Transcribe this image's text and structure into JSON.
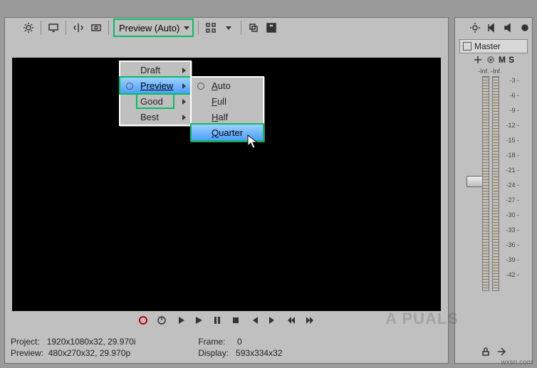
{
  "toolbar": {
    "preview_dropdown": "Preview (Auto)"
  },
  "quality_menu": {
    "items": [
      "Draft",
      "Preview",
      "Good",
      "Best"
    ],
    "selected_index": 1
  },
  "resolution_menu": {
    "items": [
      {
        "label": "Auto",
        "u": "A"
      },
      {
        "label": "Full",
        "u": "F"
      },
      {
        "label": "Half",
        "u": "H"
      },
      {
        "label": "Quarter",
        "u": "Q"
      }
    ],
    "selected_index": 3
  },
  "status": {
    "project_label": "Project:",
    "project_value": "1920x1080x32, 29.970i",
    "preview_label": "Preview:",
    "preview_value": "480x270x32, 29.970p",
    "frame_label": "Frame:",
    "frame_value": "0",
    "display_label": "Display:",
    "display_value": "593x334x32"
  },
  "mixer": {
    "title": "Master",
    "mute": "M",
    "solo": "S",
    "inf": "-Inf.",
    "ticks": [
      "3",
      "6",
      "9",
      "12",
      "15",
      "18",
      "21",
      "24",
      "27",
      "30",
      "33",
      "36",
      "39",
      "42"
    ],
    "readout": "-"
  },
  "watermark": "A     PUALS",
  "source": "wxsn.com"
}
